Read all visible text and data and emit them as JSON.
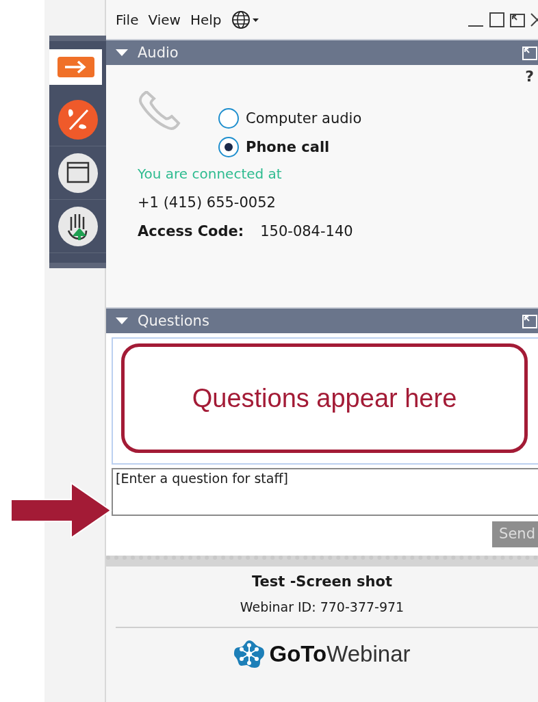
{
  "menu": [
    "File",
    "View",
    "Help"
  ],
  "toolbar_buttons": [
    {
      "kind": "exit",
      "selected": true
    },
    {
      "kind": "mute",
      "selected": false
    },
    {
      "kind": "screen",
      "selected": false
    },
    {
      "kind": "hand",
      "selected": false
    }
  ],
  "audio": {
    "title": "Audio",
    "expanded": true,
    "help": "?",
    "options": [
      {
        "label": "Computer audio",
        "selected": false
      },
      {
        "label": "Phone call",
        "selected": true
      }
    ],
    "status": "You are connected at",
    "phone": "+1 (415) 655-0052",
    "access_code_label": "Access Code:",
    "access_code": "150-084-140"
  },
  "questions": {
    "title": "Questions",
    "expanded": true,
    "callout": "Questions appear here",
    "input": {
      "placeholder": "[Enter a question for staff]"
    },
    "send": {
      "label": "Send",
      "disabled": true
    }
  },
  "footer": {
    "webinar_title": "Test -Screen shot",
    "webinar_id": "Webinar ID: 770-377-971",
    "logo": "**GoTo**Webinar"
  }
}
